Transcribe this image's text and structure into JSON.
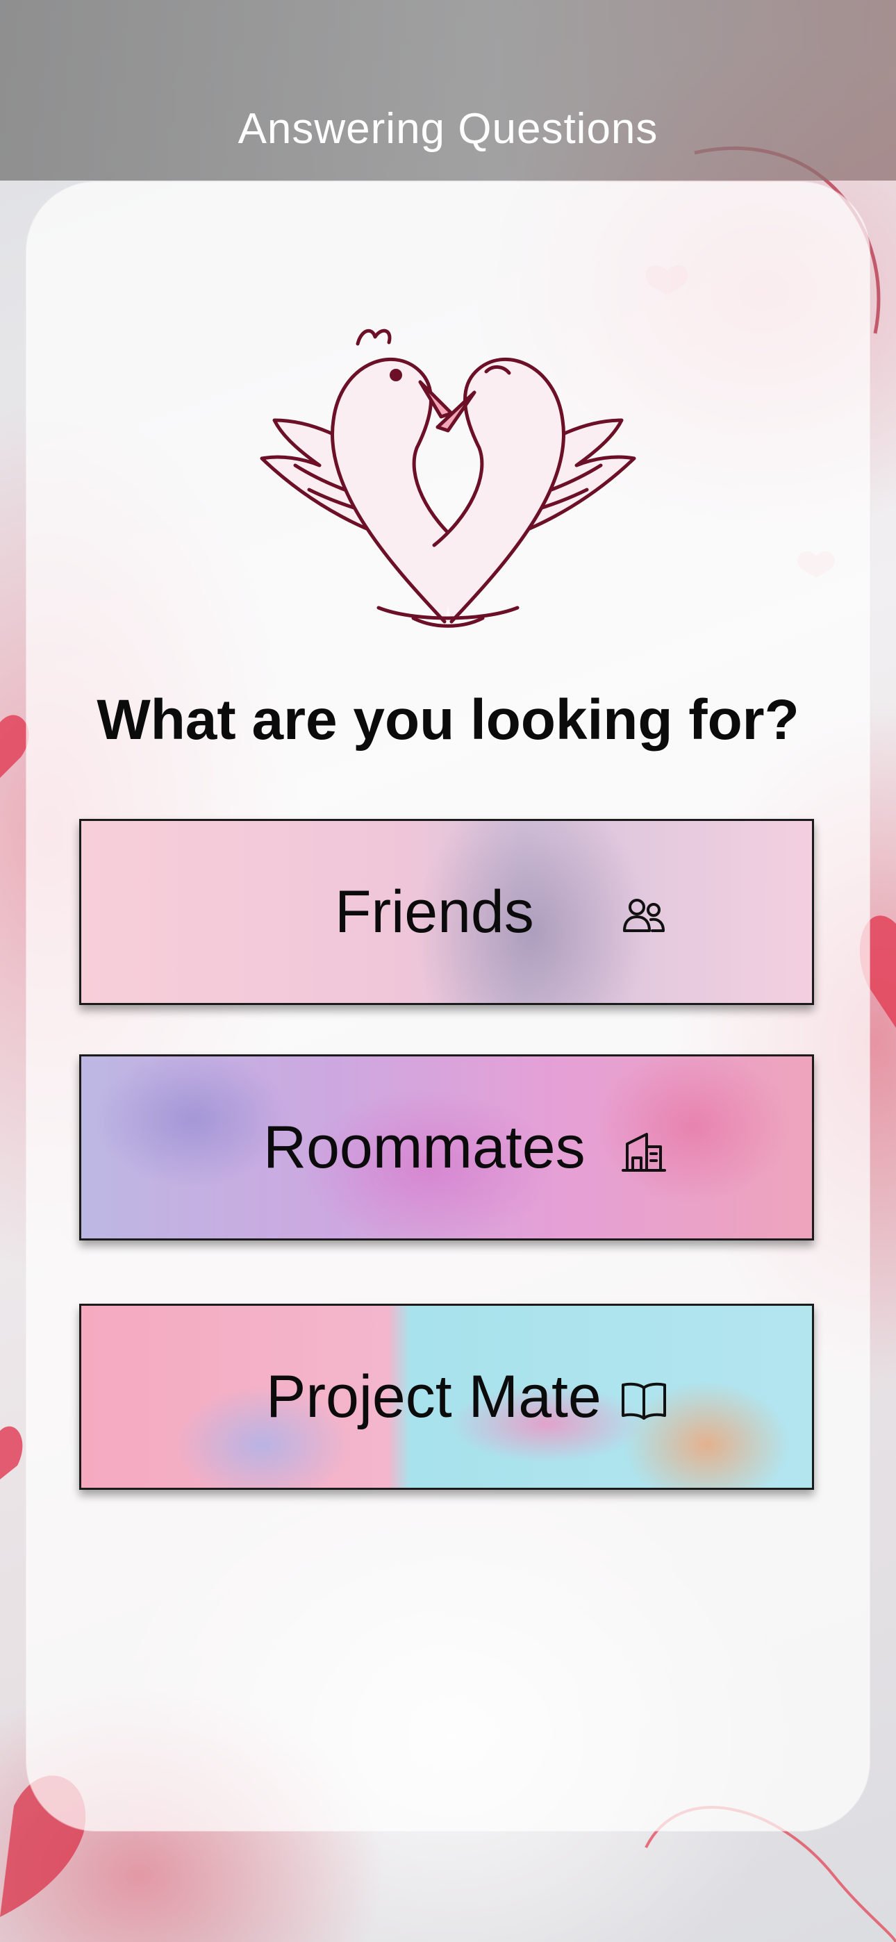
{
  "header": {
    "title": "Answering Questions"
  },
  "main": {
    "question": "What are you looking for?",
    "logo_icon": "swan-heart-logo-icon",
    "options": [
      {
        "label": "Friends",
        "icon": "people-icon"
      },
      {
        "label": "Roommates",
        "icon": "buildings-icon"
      },
      {
        "label": "Project Mate",
        "icon": "book-icon"
      }
    ]
  },
  "colors": {
    "header_bg": "#808080",
    "header_text": "#ffffff",
    "card_bg": "#ffffff",
    "question_text": "#0b0b0b",
    "logo_stroke": "#6b1027"
  }
}
